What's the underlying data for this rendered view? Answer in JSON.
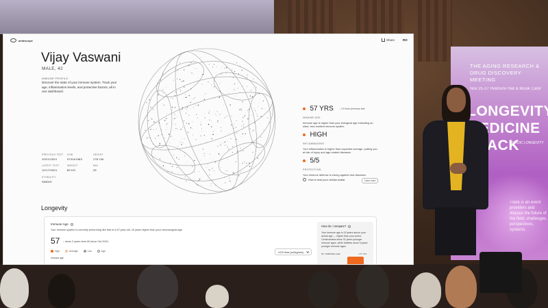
{
  "app": {
    "logo_text": "ambiscope",
    "share_label": "Share",
    "user_initials": "RO"
  },
  "patient": {
    "name": "Vijay Vaswani",
    "subtitle": "MALE, 42"
  },
  "immune_profile": {
    "title": "IMMUNE PROFILE",
    "description": "Discover the state of your immune system. Track your age, inflammation levels, and protective factors, all in one dashboard."
  },
  "stats": [
    {
      "label": "PREVIOUS TEST",
      "value": "10/21/2024"
    },
    {
      "label": "DOB",
      "value": "07/04/1983"
    },
    {
      "label": "HEIGHT",
      "value": "178 CM"
    },
    {
      "label": "LATEST TEST",
      "value": "12/17/2024"
    },
    {
      "label": "WEIGHT",
      "value": "80 KG"
    },
    {
      "label": "BMI",
      "value": "25"
    },
    {
      "label": "ETHNICITY",
      "value": "SINDHI"
    }
  ],
  "metrics": {
    "immune_age": {
      "value": "57 YRS",
      "delta": "2.6 from previous test",
      "label": "IMMUNE AGE",
      "description": "Immune age is higher than your biological age indicating an older, less resilient immune system."
    },
    "inflammaging": {
      "value": "HIGH",
      "label": "INFLAMMAGING",
      "description": "Your inflammation is higher than expected average, putting you at risk of injury and age-related diseases."
    },
    "protection": {
      "value": "5/5",
      "label": "PROTECTION",
      "description": "Your immune defense is strong against viral diseases."
    },
    "avatar_link": "How to read your cellular avatar",
    "learn_more": "Learn more"
  },
  "longevity": {
    "section_title": "Longevity",
    "card": {
      "title": "Immune Age",
      "description": "Your immune system is currently performing like that of a 57-year-old, 15 years higher than your chronological age.",
      "value": "57",
      "delta": "down 2 years from 60 since Oct 2024",
      "legend": [
        {
          "label": "High",
          "color": "#ef6a1e"
        },
        {
          "label": "Average",
          "color": "#f3c29a"
        },
        {
          "label": "Low",
          "color": "#9a9a9a"
        },
        {
          "label": "Age",
          "color": "#ffffff"
        }
      ],
      "tag": "Immune age",
      "dropdown": "VO2 Max (ml/kg/min)"
    },
    "compare": {
      "title": "How do I compare?",
      "description": "Your immune age is 15 years above your actual age — higher than your peers. Centenarians show 32 years younger immune ages, while athletes show 5 years younger immune ages.",
      "tag": "MY IMMUNE AGE",
      "number": "+15 YRS"
    }
  },
  "banner": {
    "line1": "THE AGING RESEARCH & DRUG DISCOVERY MEETING",
    "date": "Nov 25-27 Hvidovre Hall & Musik Calor",
    "big1": "LONGEVITY",
    "big2": "MEDICINE",
    "big3": "TRACK",
    "small": "NORDIC LONGEVITY",
    "text": "Track is an event providers and discuss the future of the field, challenges, perspectives, systems."
  },
  "colors": {
    "accent": "#ef6a1e",
    "screen_bg": "#fbfbfb",
    "banner_pink": "#c48bd0"
  }
}
